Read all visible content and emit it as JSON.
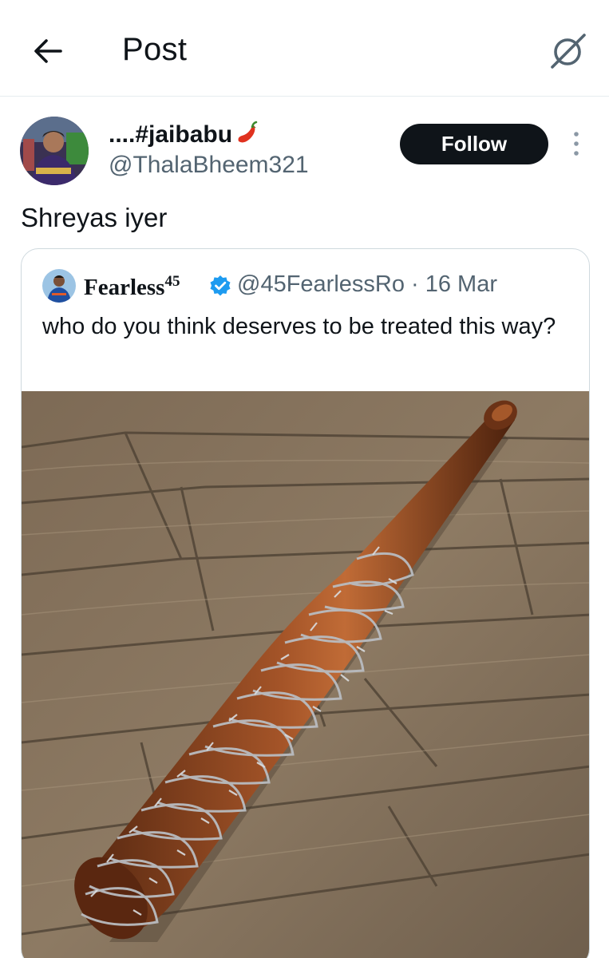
{
  "header": {
    "title": "Post",
    "back_icon": "arrow-left-icon",
    "grok_icon": "grok-icon"
  },
  "post": {
    "display_name": "....#jaibabu",
    "name_emoji": "chili-pepper-icon",
    "handle": "@ThalaBheem321",
    "follow_label": "Follow",
    "more_icon": "more-vertical-icon",
    "text": "Shreyas iyer"
  },
  "quote": {
    "display_name": "Fearless",
    "name_superscript": "45",
    "verified_icon": "verified-badge-icon",
    "handle_and_date": "@45FearlessRo · 16 Mar",
    "text": "who do you think deserves to be treated this way?",
    "media": "photo of a wooden baseball bat wrapped in barbed wire lying on a wooden floor"
  },
  "colors": {
    "primary_text": "#0f1419",
    "secondary_text": "#536471",
    "follow_bg": "#0f1419",
    "verified": "#1d9bf0",
    "border": "#cfd9de"
  }
}
